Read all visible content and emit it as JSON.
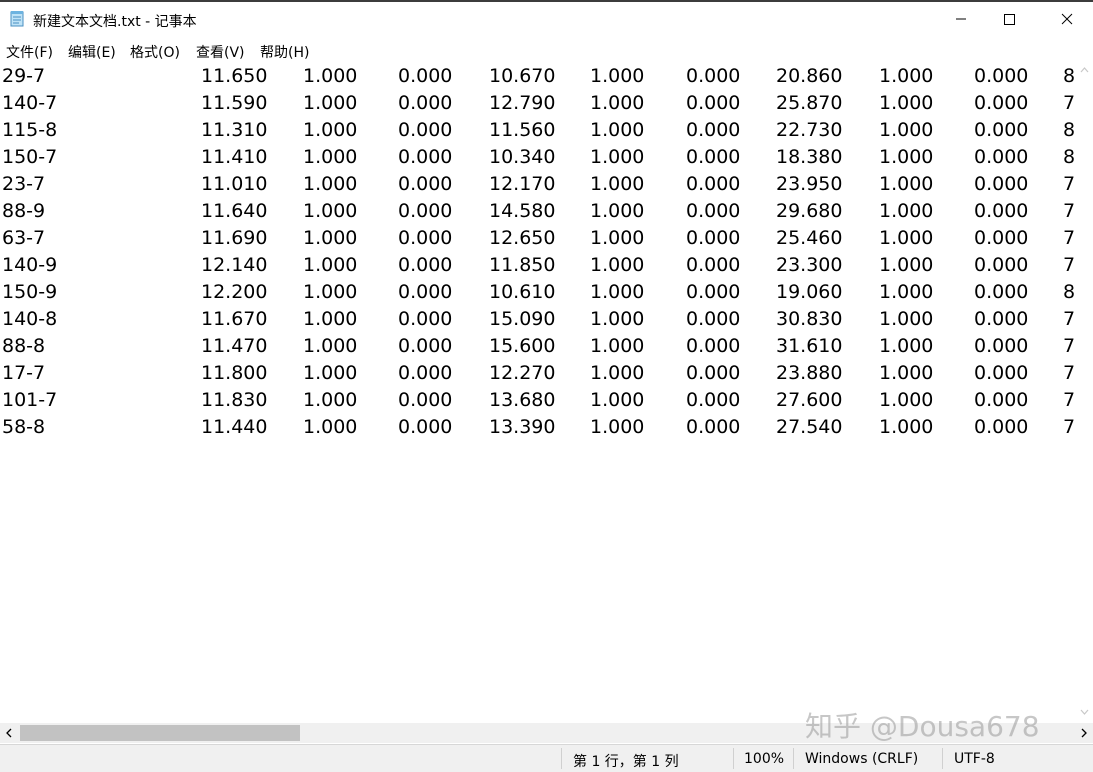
{
  "window": {
    "title": "新建文本文档.txt - 记事本"
  },
  "menu": [
    "文件(F)",
    "编辑(E)",
    "格式(O)",
    "查看(V)",
    "帮助(H)"
  ],
  "rows": [
    [
      "29-7",
      "11.650",
      "1.000",
      "0.000",
      "10.670",
      "1.000",
      "0.000",
      "20.860",
      "1.000",
      "0.000",
      "8"
    ],
    [
      "140-7",
      "11.590",
      "1.000",
      "0.000",
      "12.790",
      "1.000",
      "0.000",
      "25.870",
      "1.000",
      "0.000",
      "7"
    ],
    [
      "115-8",
      "11.310",
      "1.000",
      "0.000",
      "11.560",
      "1.000",
      "0.000",
      "22.730",
      "1.000",
      "0.000",
      "8"
    ],
    [
      "150-7",
      "11.410",
      "1.000",
      "0.000",
      "10.340",
      "1.000",
      "0.000",
      "18.380",
      "1.000",
      "0.000",
      "8"
    ],
    [
      "23-7",
      "11.010",
      "1.000",
      "0.000",
      "12.170",
      "1.000",
      "0.000",
      "23.950",
      "1.000",
      "0.000",
      "7"
    ],
    [
      "88-9",
      "11.640",
      "1.000",
      "0.000",
      "14.580",
      "1.000",
      "0.000",
      "29.680",
      "1.000",
      "0.000",
      "7"
    ],
    [
      "63-7",
      "11.690",
      "1.000",
      "0.000",
      "12.650",
      "1.000",
      "0.000",
      "25.460",
      "1.000",
      "0.000",
      "7"
    ],
    [
      "140-9",
      "12.140",
      "1.000",
      "0.000",
      "11.850",
      "1.000",
      "0.000",
      "23.300",
      "1.000",
      "0.000",
      "7"
    ],
    [
      "150-9",
      "12.200",
      "1.000",
      "0.000",
      "10.610",
      "1.000",
      "0.000",
      "19.060",
      "1.000",
      "0.000",
      "8"
    ],
    [
      "140-8",
      "11.670",
      "1.000",
      "0.000",
      "15.090",
      "1.000",
      "0.000",
      "30.830",
      "1.000",
      "0.000",
      "7"
    ],
    [
      "88-8",
      "11.470",
      "1.000",
      "0.000",
      "15.600",
      "1.000",
      "0.000",
      "31.610",
      "1.000",
      "0.000",
      "7"
    ],
    [
      "17-7",
      "11.800",
      "1.000",
      "0.000",
      "12.270",
      "1.000",
      "0.000",
      "23.880",
      "1.000",
      "0.000",
      "7"
    ],
    [
      "101-7",
      "11.830",
      "1.000",
      "0.000",
      "13.680",
      "1.000",
      "0.000",
      "27.600",
      "1.000",
      "0.000",
      "7"
    ],
    [
      "58-8",
      "11.440",
      "1.000",
      "0.000",
      "13.390",
      "1.000",
      "0.000",
      "27.540",
      "1.000",
      "0.000",
      "7"
    ]
  ],
  "status": {
    "position": "第 1 行，第 1 列",
    "zoom": "100%",
    "line_ending": "Windows (CRLF)",
    "encoding": "UTF-8"
  },
  "watermark": "知乎 @Dousa678",
  "icons": [
    "notepad-icon",
    "minimize-icon",
    "maximize-icon",
    "close-icon",
    "scroll-left-icon",
    "scroll-right-icon",
    "scroll-up-icon",
    "scroll-down-icon"
  ],
  "colors": {
    "chrome_bg": "#f0f0f0",
    "text": "#000000",
    "scroll_thumb": "#c2c2c2"
  }
}
